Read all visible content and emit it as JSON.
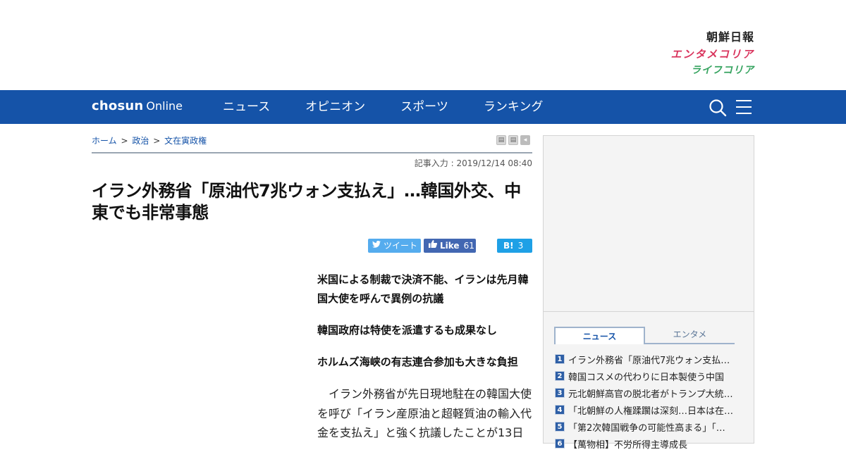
{
  "masthead": {
    "brand_chosun": "朝鮮日報",
    "brand_entame": "エンタメコリア",
    "brand_life": "ライフコリア"
  },
  "nav": {
    "logo_word": "chosun",
    "logo_suffix": "Online",
    "items": [
      "ニュース",
      "オピニオン",
      "スポーツ",
      "ランキング"
    ]
  },
  "breadcrumb": {
    "home": "ホーム",
    "sep": ">",
    "section": "政治",
    "subsection": "文在寅政権"
  },
  "article": {
    "dateline": "記事入力 : 2019/12/14 08:40",
    "headline": "イラン外務省「原油代7兆ウォン支払え」…韓国外交、中東でも非常事態",
    "subheads": [
      "米国による制裁で決済不能、イランは先月韓国大使を呼んで異例の抗議",
      "韓国政府は特使を派遣するも成果なし",
      "ホルムズ海峡の有志連合参加も大きな負担"
    ],
    "body": "イラン外務省が先日現地駐在の韓国大使を呼び「イラン産原油と超軽質油の輸入代金を支払え」と強く抗議したことが13日"
  },
  "share": {
    "tweet_label": "ツイート",
    "like_label": "Like",
    "like_count": "61",
    "hatena_label": "B!",
    "hatena_count": "3"
  },
  "sidebar": {
    "tabs": [
      "ニュース",
      "エンタメ"
    ],
    "ranking": [
      {
        "num": "1",
        "title": "イラン外務省「原油代7兆ウォン支払…"
      },
      {
        "num": "2",
        "title": "韓国コスメの代わりに日本製使う中国"
      },
      {
        "num": "3",
        "title": "元北朝鮮高官の脱北者がトランプ大統…"
      },
      {
        "num": "4",
        "title": "「北朝鮮の人権蹂躙は深刻…日本は在…"
      },
      {
        "num": "5",
        "title": "「第2次韓国戦争の可能性高まる」「…"
      },
      {
        "num": "6",
        "title": "【萬物相】不労所得主導成長"
      }
    ]
  },
  "colors": {
    "nav_bg": "#1553a8",
    "entame_brand": "#d9335c",
    "life_brand": "#35a35f",
    "tweet": "#55acee",
    "facebook": "#4267b2",
    "hatena": "#1ea0e6"
  }
}
